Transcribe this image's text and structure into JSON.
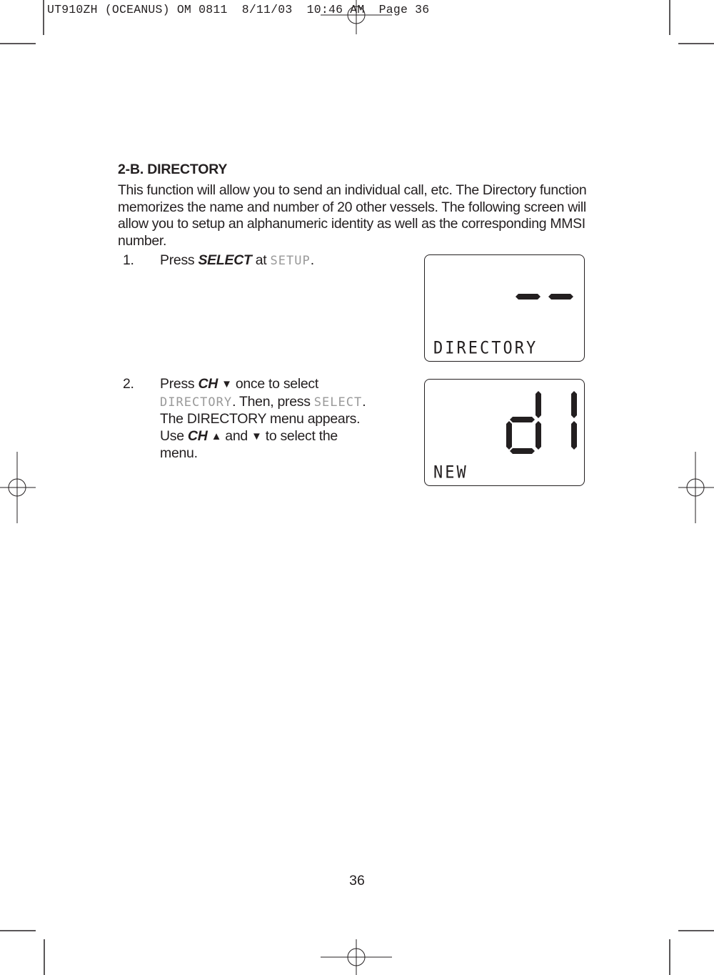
{
  "print_slug": "UT910ZH (OCEANUS) OM 0811  8/11/03  10:46 AM  Page 36",
  "section": {
    "heading": "2-B. DIRECTORY",
    "intro": "This function will allow you to send an individual call, etc.  The Directory function memorizes the name and number of 20 other vessels.  The following screen will allow you to setup an alphanumeric identity as well as the corresponding MMSI number."
  },
  "steps": [
    {
      "number": "1.",
      "parts": {
        "press": "Press ",
        "key": "SELECT",
        "at": " at ",
        "lcd_word": "SETUP",
        "end": "."
      }
    },
    {
      "number": "2.",
      "parts": {
        "press": "Press ",
        "key": "CH",
        "down": "▼",
        "once": " once to select",
        "lcd_word": "DIRECTORY",
        "then": ".  Then, press ",
        "lcd_word2": "SELECT",
        "end": ".",
        "line3": "The DIRECTORY menu appears.",
        "use": "Use ",
        "key2": "CH",
        "up": "▲",
        "and": " and ",
        "down2": "▼",
        "toselect": " to select the",
        "line5": "menu."
      }
    }
  ],
  "lcd_screens": [
    {
      "label": "DIRECTORY",
      "segment_display": "--"
    },
    {
      "label": "NEW",
      "segment_display": "d1"
    }
  ],
  "page_number": "36"
}
